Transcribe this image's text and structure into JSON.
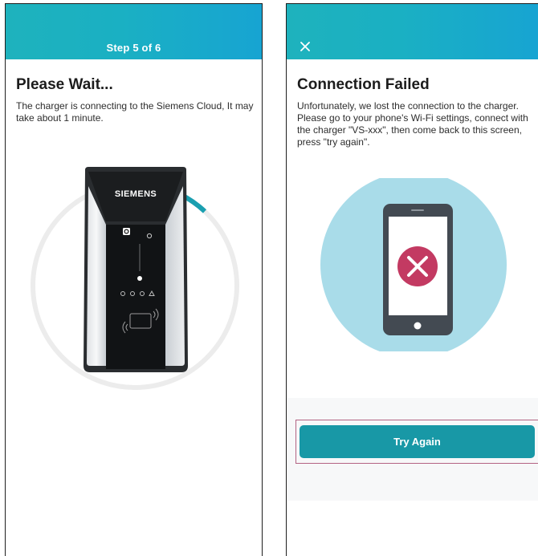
{
  "screen_left": {
    "step": "Step 5 of 6",
    "title": "Please Wait...",
    "message": "The charger is connecting to the Siemens Cloud, It may take about 1 minute.",
    "charger_brand": "SIEMENS",
    "progress_fraction": 0.12,
    "colors": {
      "accent": "#1a9fb0",
      "ring_track": "#ececec"
    }
  },
  "screen_right": {
    "close_icon": "close-icon",
    "title": "Connection Failed",
    "message": "Unfortunately, we lost the connection to the charger.  Please go to your phone's Wi-Fi settings, connect with the charger \"VS-xxx\", then come back to this screen, press \"try again\".",
    "button_label": "Try Again",
    "status_icon": "error-x-icon",
    "colors": {
      "button": "#1898a6",
      "error": "#c33a62",
      "circle": "#a9dce9"
    }
  },
  "header_gradient": [
    "#1eb2bd",
    "#17a4d2"
  ]
}
